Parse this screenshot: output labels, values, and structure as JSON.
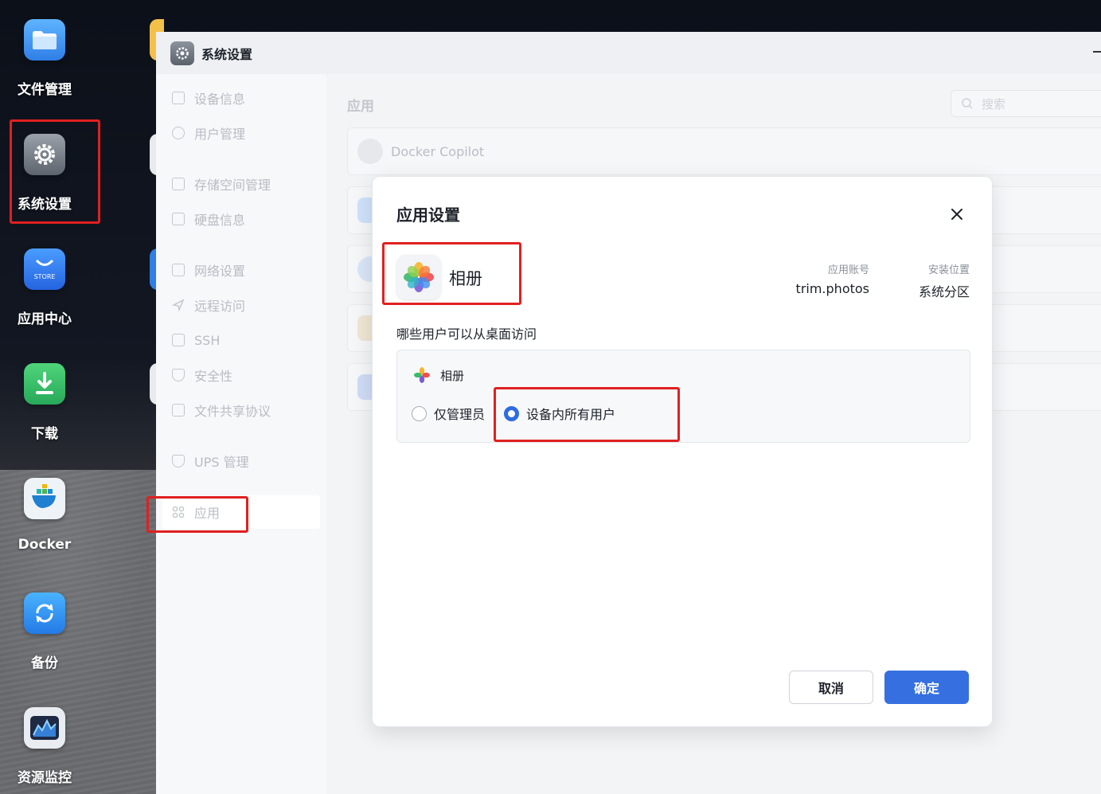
{
  "desktop": {
    "icons": [
      {
        "label": "文件管理",
        "icon": "folder-icon"
      },
      {
        "label": "系统设置",
        "icon": "gear-icon"
      },
      {
        "label": "应用中心",
        "icon": "store-icon",
        "badge": "STORE"
      },
      {
        "label": "下载",
        "icon": "download-icon"
      },
      {
        "label": "Docker",
        "icon": "docker-whale-icon"
      },
      {
        "label": "备份",
        "icon": "backup-sync-icon"
      },
      {
        "label": "资源监控",
        "icon": "monitor-chart-icon"
      }
    ]
  },
  "window": {
    "title": "系统设置",
    "sidebar": [
      {
        "label": "设备信息",
        "icon": "device-icon"
      },
      {
        "label": "用户管理",
        "icon": "user-icon"
      },
      {
        "label": "存储空间管理",
        "icon": "storage-icon"
      },
      {
        "label": "硬盘信息",
        "icon": "disk-icon"
      },
      {
        "label": "网络设置",
        "icon": "network-icon"
      },
      {
        "label": "远程访问",
        "icon": "remote-icon"
      },
      {
        "label": "SSH",
        "icon": "ssh-icon"
      },
      {
        "label": "安全性",
        "icon": "shield-icon"
      },
      {
        "label": "文件共享协议",
        "icon": "file-share-icon"
      },
      {
        "label": "UPS 管理",
        "icon": "ups-icon"
      },
      {
        "label": "应用",
        "icon": "apps-icon",
        "active": true
      }
    ],
    "content": {
      "heading": "应用",
      "search_placeholder": "搜索",
      "apps": [
        {
          "name": "Docker Copilot"
        }
      ]
    }
  },
  "modal": {
    "title": "应用设置",
    "app_name": "相册",
    "account_label": "应用账号",
    "account_value": "trim.photos",
    "location_label": "安装位置",
    "location_value": "系统分区",
    "question": "哪些用户可以从桌面访问",
    "panel_app_name": "相册",
    "options": [
      {
        "label": "仅管理员",
        "selected": false
      },
      {
        "label": "设备内所有用户",
        "selected": true
      }
    ],
    "cancel_label": "取消",
    "ok_label": "确定"
  },
  "colors": {
    "highlight": "#e02020",
    "primary": "#3670e0"
  }
}
